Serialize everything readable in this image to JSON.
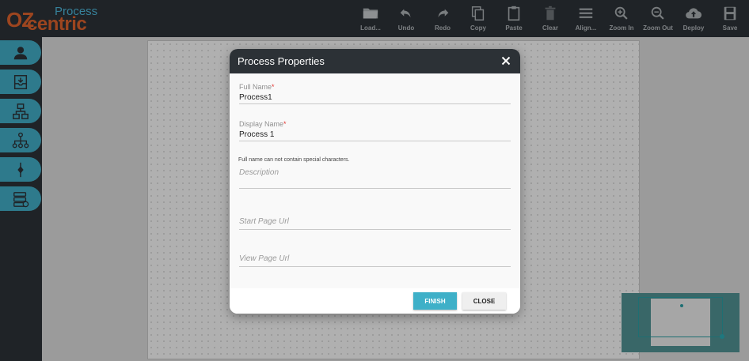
{
  "logo": {
    "oz": "OZ",
    "centric": "centric",
    "process": "Process"
  },
  "toolbar": {
    "items": [
      {
        "label": "Load...",
        "icon": "folder-icon"
      },
      {
        "label": "Undo",
        "icon": "undo-icon"
      },
      {
        "label": "Redo",
        "icon": "redo-icon"
      },
      {
        "label": "Copy",
        "icon": "copy-icon"
      },
      {
        "label": "Paste",
        "icon": "paste-icon"
      },
      {
        "label": "Clear",
        "icon": "trash-icon"
      },
      {
        "label": "Align...",
        "icon": "align-icon"
      },
      {
        "label": "Zoom In",
        "icon": "zoom-in-icon"
      },
      {
        "label": "Zoom Out",
        "icon": "zoom-out-icon"
      },
      {
        "label": "Deploy",
        "icon": "cloud-upload-icon"
      },
      {
        "label": "Save",
        "icon": "save-icon"
      }
    ]
  },
  "sidebar": {
    "items": [
      {
        "icon": "user-icon"
      },
      {
        "icon": "inbox-icon"
      },
      {
        "icon": "org-chart-icon"
      },
      {
        "icon": "hierarchy-icon"
      },
      {
        "icon": "connector-icon"
      },
      {
        "icon": "database-icon"
      }
    ]
  },
  "dialog": {
    "title": "Process Properties",
    "full_name": {
      "label": "Full Name",
      "required": "*",
      "value": "Process1",
      "help": "Full name can not contain special characters."
    },
    "display_name": {
      "label": "Display Name",
      "required": "*",
      "value": "Process 1"
    },
    "description": {
      "placeholder": "Description"
    },
    "start_page_url": {
      "placeholder": "Start Page Url"
    },
    "view_page_url": {
      "placeholder": "View Page Url"
    },
    "finish_label": "FINISH",
    "close_label": "CLOSE"
  },
  "colors": {
    "topbar": "#2c3136",
    "accent": "#41aac3",
    "logo_orange": "#d9602b",
    "logo_blue": "#4bb3d6",
    "required": "#e53935"
  }
}
